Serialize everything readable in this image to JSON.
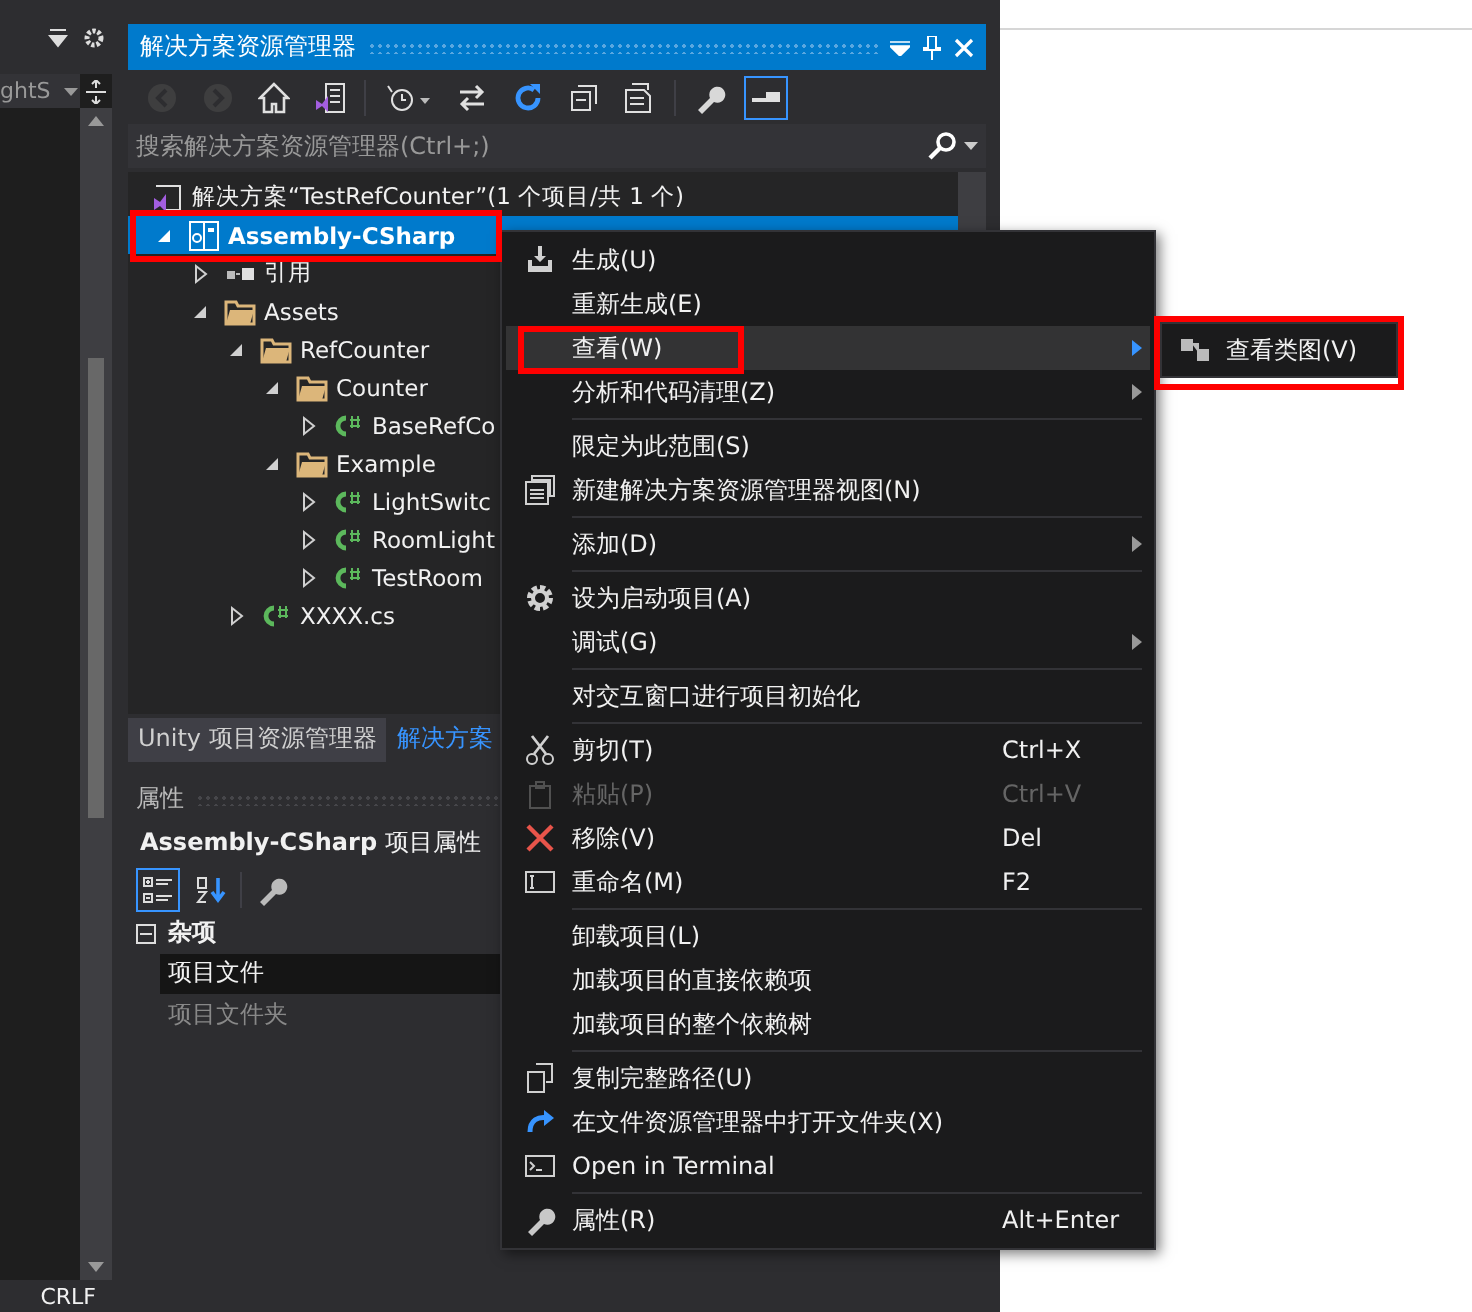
{
  "left_panel": {
    "dropdown": "ghtS",
    "status": "CRLF"
  },
  "explorer": {
    "title": "解决方案资源管理器",
    "toolbar": [
      {
        "disabled": true,
        "selected": false
      },
      {
        "disabled": true,
        "selected": false
      },
      {
        "disabled": false,
        "selected": false
      },
      {
        "disabled": false,
        "selected": false
      },
      {
        "disabled": false,
        "selected": false
      },
      {
        "disabled": false,
        "selected": false
      },
      {
        "disabled": false,
        "selected": false
      },
      {
        "disabled": false,
        "selected": false
      },
      {
        "disabled": false,
        "selected": false
      },
      {
        "disabled": false,
        "selected": false
      },
      {
        "disabled": false,
        "selected": true
      }
    ],
    "search": {
      "placeholder": "搜索解决方案资源管理器(Ctrl+;)"
    },
    "solution": {
      "label": "解决方案“TestRefCounter”(1 个项目/共 1 个)",
      "selected": false
    },
    "tree": [
      {
        "kind": "project",
        "label": "Assembly-CSharp",
        "expanded": true,
        "selected": true,
        "children": [
          {
            "kind": "references",
            "label": "引用",
            "expanded": false,
            "selected": false
          },
          {
            "kind": "folder",
            "label": "Assets",
            "expanded": true,
            "selected": false,
            "children": [
              {
                "kind": "folder",
                "label": "RefCounter",
                "expanded": true,
                "selected": false,
                "children": [
                  {
                    "kind": "folder",
                    "label": "Counter",
                    "expanded": true,
                    "selected": false,
                    "children": [
                      {
                        "kind": "csharp",
                        "label": "BaseRefCo",
                        "expanded": false,
                        "selected": false
                      }
                    ]
                  },
                  {
                    "kind": "folder",
                    "label": "Example",
                    "expanded": true,
                    "selected": false,
                    "children": [
                      {
                        "kind": "csharp",
                        "label": "LightSwitc",
                        "expanded": false,
                        "selected": false
                      },
                      {
                        "kind": "csharp",
                        "label": "RoomLight",
                        "expanded": false,
                        "selected": false
                      },
                      {
                        "kind": "csharp",
                        "label": "TestRoom",
                        "expanded": false,
                        "selected": false
                      }
                    ]
                  }
                ]
              },
              {
                "kind": "csharp",
                "label": "XXXX.cs",
                "expanded": false,
                "selected": false
              }
            ]
          }
        ]
      }
    ]
  },
  "tabs": [
    {
      "label": "Unity 项目资源管理器",
      "selected": false
    },
    {
      "label": "解决方案",
      "selected": true
    }
  ],
  "properties": {
    "title": "属性",
    "subject": "**Assembly-CSharp** 项目属性",
    "toolbar": [
      {
        "selected": true
      },
      {
        "selected": false
      },
      {
        "selected": false
      }
    ],
    "group": {
      "label": "杂项",
      "expanded": true
    },
    "rows": [
      {
        "label": "项目文件",
        "selected": true,
        "disabled": false
      },
      {
        "label": "项目文件夹",
        "selected": false,
        "disabled": true
      }
    ]
  },
  "context_menu": {
    "items": [
      {
        "kind": "item",
        "label": "生成(U)",
        "selected": false,
        "disabled": false,
        "submenu": false
      },
      {
        "kind": "item",
        "label": "重新生成(E)",
        "selected": false,
        "disabled": false,
        "submenu": false
      },
      {
        "kind": "item",
        "label": "查看(W)",
        "selected": true,
        "disabled": false,
        "submenu": true
      },
      {
        "kind": "item",
        "label": "分析和代码清理(Z)",
        "selected": false,
        "disabled": false,
        "submenu": true
      },
      {
        "kind": "separator"
      },
      {
        "kind": "item",
        "label": "限定为此范围(S)",
        "selected": false,
        "disabled": false,
        "submenu": false
      },
      {
        "kind": "item",
        "label": "新建解决方案资源管理器视图(N)",
        "selected": false,
        "disabled": false,
        "submenu": false
      },
      {
        "kind": "separator"
      },
      {
        "kind": "item",
        "label": "添加(D)",
        "selected": false,
        "disabled": false,
        "submenu": true
      },
      {
        "kind": "separator"
      },
      {
        "kind": "item",
        "label": "设为启动项目(A)",
        "selected": false,
        "disabled": false,
        "submenu": false
      },
      {
        "kind": "item",
        "label": "调试(G)",
        "selected": false,
        "disabled": false,
        "submenu": true
      },
      {
        "kind": "separator"
      },
      {
        "kind": "item",
        "label": "对交互窗口进行项目初始化",
        "selected": false,
        "disabled": false,
        "submenu": false
      },
      {
        "kind": "separator"
      },
      {
        "kind": "item",
        "label": "剪切(T)",
        "shortcut": "Ctrl+X",
        "selected": false,
        "disabled": false,
        "submenu": false
      },
      {
        "kind": "item",
        "label": "粘贴(P)",
        "shortcut": "Ctrl+V",
        "selected": false,
        "disabled": true,
        "submenu": false
      },
      {
        "kind": "item",
        "label": "移除(V)",
        "shortcut": "Del",
        "selected": false,
        "disabled": false,
        "submenu": false
      },
      {
        "kind": "item",
        "label": "重命名(M)",
        "shortcut": "F2",
        "selected": false,
        "disabled": false,
        "submenu": false
      },
      {
        "kind": "separator"
      },
      {
        "kind": "item",
        "label": "卸载项目(L)",
        "selected": false,
        "disabled": false,
        "submenu": false
      },
      {
        "kind": "item",
        "label": "加载项目的直接依赖项",
        "selected": false,
        "disabled": false,
        "submenu": false
      },
      {
        "kind": "item",
        "label": "加载项目的整个依赖树",
        "selected": false,
        "disabled": false,
        "submenu": false
      },
      {
        "kind": "separator"
      },
      {
        "kind": "item",
        "label": "复制完整路径(U)",
        "selected": false,
        "disabled": false,
        "submenu": false
      },
      {
        "kind": "item",
        "label": "在文件资源管理器中打开文件夹(X)",
        "selected": false,
        "disabled": false,
        "submenu": false
      },
      {
        "kind": "item",
        "label": "Open in Terminal",
        "selected": false,
        "disabled": false,
        "submenu": false
      },
      {
        "kind": "separator"
      },
      {
        "kind": "item",
        "label": "属性(R)",
        "shortcut": "Alt+Enter",
        "selected": false,
        "disabled": false,
        "submenu": false
      }
    ]
  },
  "submenu": {
    "items": [
      {
        "label": "查看类图(V)",
        "selected": false
      }
    ]
  }
}
